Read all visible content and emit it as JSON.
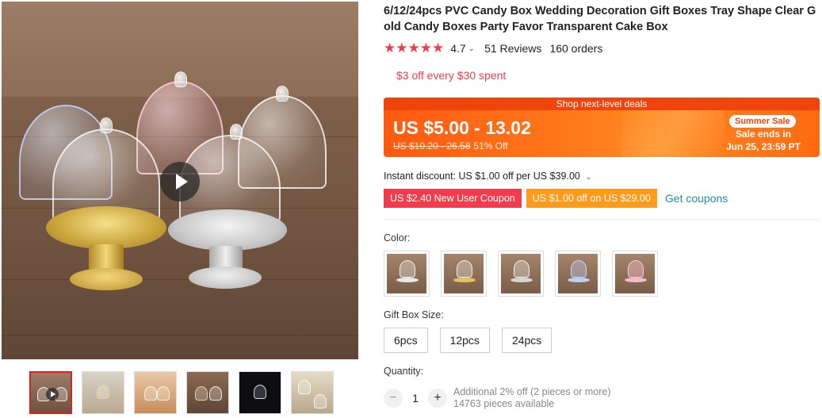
{
  "product": {
    "title": "6/12/24pcs PVC Candy Box Wedding Decoration Gift Boxes Tray Shape Clear Gold Candy Boxes Party Favor Transparent Cake Box",
    "stars": "★★★★★",
    "rating": "4.7",
    "rating_chevron": "⌄",
    "reviews": "51 Reviews",
    "orders": "160 orders"
  },
  "promo": {
    "store_offer": "$3 off every $30 spent"
  },
  "price_banner": {
    "header": "Shop next-level deals",
    "price": "US $5.00 - 13.02",
    "original_price": "US $10.20 - 26.58",
    "discount": "51% Off",
    "sale_badge": "Summer Sale",
    "sale_ends_label": "Sale ends in",
    "sale_ends_time": "Jun 25, 23:59 PT"
  },
  "discounts": {
    "instant": "Instant discount: US $1.00 off per US $39.00",
    "instant_chevron": "⌄",
    "coupon_new_user": "US $2.40 New User Coupon",
    "coupon_store": "US $1.00 off on US $29.00",
    "get_coupons": "Get coupons"
  },
  "options": {
    "color_label": "Color:",
    "size_label": "Gift Box Size:",
    "sizes": [
      "6pcs",
      "12pcs",
      "24pcs"
    ],
    "quantity_label": "Quantity:",
    "quantity": "1",
    "minus": "−",
    "plus": "+",
    "bulk_note": "Additional 2% off (2 pieces or more)",
    "available": "14763 pieces available"
  },
  "colors": {
    "star": "#f23b4c",
    "banner": "#ff6a10",
    "coupon_orange": "#ff9a1a",
    "link": "#1f8fa5"
  },
  "icons": {
    "play": "play-icon",
    "star": "star-icon",
    "chevron": "chevron-down-icon"
  }
}
